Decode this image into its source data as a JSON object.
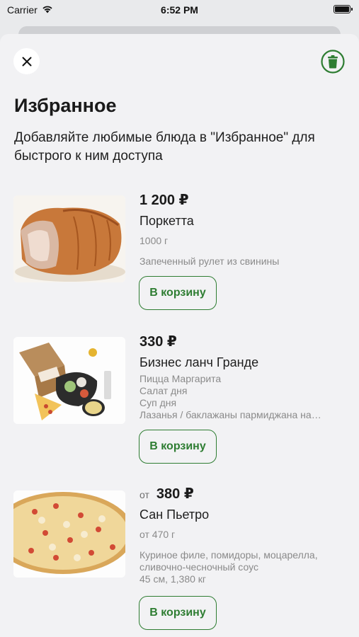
{
  "status_bar": {
    "carrier": "Carrier",
    "time": "6:52 PM"
  },
  "header": {
    "title": "Избранное",
    "subtitle": "Добавляйте любимые блюда в \"Избранное\" для быстрого к ним доступа"
  },
  "colors": {
    "accent": "#2e7d32",
    "background": "#f2f2f4"
  },
  "icons": {
    "close": "close-icon",
    "trash": "trash-icon"
  },
  "items": [
    {
      "price_prefix": "",
      "price": "1 200 ₽",
      "name": "Поркетта",
      "weight": "1000 г",
      "description": [
        "Запеченный рулет из свинины"
      ],
      "button": "В корзину"
    },
    {
      "price_prefix": "",
      "price": "330 ₽",
      "name": "Бизнес ланч Гранде",
      "weight": "",
      "description": [
        "Пицца Маргарита",
        "Салат дня",
        "Суп дня",
        "Лазанья / баклажаны пармиджана на…"
      ],
      "button": "В корзину"
    },
    {
      "price_prefix": "от",
      "price": "380 ₽",
      "name": "Сан Пьетро",
      "weight": "от 470 г",
      "description": [
        "Куриное филе, помидоры, моцарелла,",
        "сливочно-чесночный соус",
        "45 см, 1,380 кг"
      ],
      "button": "В корзину"
    }
  ]
}
